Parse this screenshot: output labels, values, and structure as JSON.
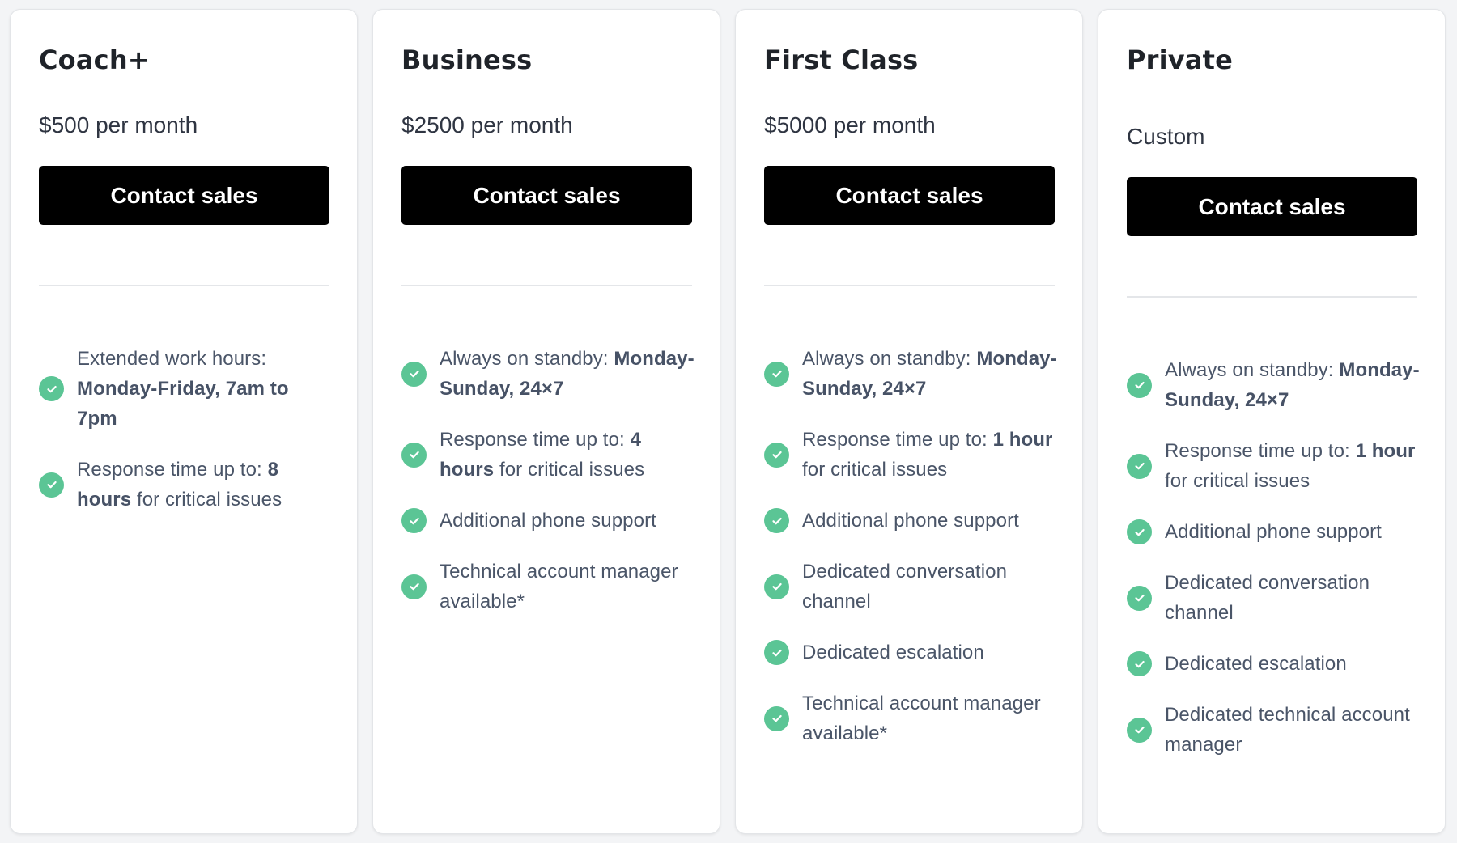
{
  "colors": {
    "background": "#f3f4f6",
    "card": "#ffffff",
    "button": "#000000",
    "check": "#5bc595",
    "title": "#1f2329",
    "feature_text": "#4a5568"
  },
  "plans": [
    {
      "name": "Coach+",
      "price": "$500 per month",
      "cta": "Contact sales",
      "features": [
        {
          "prefix": "Extended work hours: ",
          "bold": "Monday-Friday, 7am to 7pm",
          "suffix": ""
        },
        {
          "prefix": "Response time up to: ",
          "bold": "8 hours",
          "suffix": " for critical issues"
        }
      ]
    },
    {
      "name": "Business",
      "price": "$2500 per month",
      "cta": "Contact sales",
      "features": [
        {
          "prefix": "Always on standby: ",
          "bold": "Monday-Sunday, 24×7",
          "suffix": ""
        },
        {
          "prefix": "Response time up to: ",
          "bold": "4 hours",
          "suffix": " for critical issues"
        },
        {
          "prefix": "Additional phone support",
          "bold": "",
          "suffix": ""
        },
        {
          "prefix": "Technical account manager available*",
          "bold": "",
          "suffix": ""
        }
      ]
    },
    {
      "name": "First Class",
      "price": "$5000 per month",
      "cta": "Contact sales",
      "features": [
        {
          "prefix": "Always on standby: ",
          "bold": "Monday-Sunday, 24×7",
          "suffix": ""
        },
        {
          "prefix": "Response time up to: ",
          "bold": "1 hour",
          "suffix": " for critical issues"
        },
        {
          "prefix": "Additional phone support",
          "bold": "",
          "suffix": ""
        },
        {
          "prefix": "Dedicated conversation channel",
          "bold": "",
          "suffix": ""
        },
        {
          "prefix": "Dedicated escalation",
          "bold": "",
          "suffix": ""
        },
        {
          "prefix": "Technical account manager available*",
          "bold": "",
          "suffix": ""
        }
      ]
    },
    {
      "name": "Private",
      "price": "Custom",
      "cta": "Contact sales",
      "features": [
        {
          "prefix": "Always on standby: ",
          "bold": "Monday-Sunday, 24×7",
          "suffix": ""
        },
        {
          "prefix": "Response time up to: ",
          "bold": "1 hour",
          "suffix": " for critical issues"
        },
        {
          "prefix": "Additional phone support",
          "bold": "",
          "suffix": ""
        },
        {
          "prefix": "Dedicated conversation channel",
          "bold": "",
          "suffix": ""
        },
        {
          "prefix": "Dedicated escalation",
          "bold": "",
          "suffix": ""
        },
        {
          "prefix": "Dedicated technical account manager",
          "bold": "",
          "suffix": ""
        }
      ]
    }
  ]
}
